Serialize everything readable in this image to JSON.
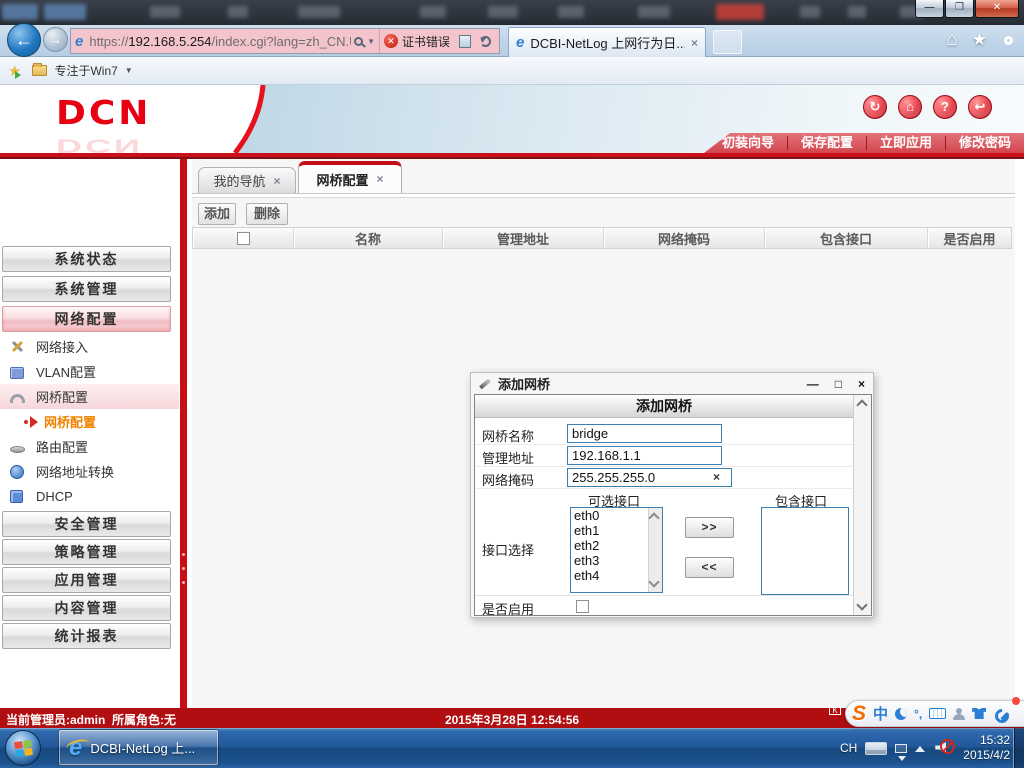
{
  "colors": {
    "brand_red": "#e60012",
    "toolbar_red": "#c9101b",
    "status_red": "#b10e12",
    "input_border": "#3c7fb1",
    "submenu_active_orange": "#f08300"
  },
  "chrome": {
    "url": {
      "scheme": "https://",
      "host": "192.168.5.254",
      "path": "/index.cgi?lang=zh_CN.U"
    },
    "cert_error": "证书错误",
    "tab_title": "DCBI-NetLog 上网行为日...",
    "favorites_item": "专注于Win7"
  },
  "header": {
    "logo": "DCN"
  },
  "ribbon": {
    "items": [
      {
        "label": "初装向导"
      },
      {
        "label": "保存配置"
      },
      {
        "label": "立即应用"
      },
      {
        "label": "修改密码"
      }
    ]
  },
  "sidebar": {
    "top_buttons": [
      {
        "label": "系统状态"
      },
      {
        "label": "系统管理"
      },
      {
        "label": "网络配置"
      }
    ],
    "submenu": [
      {
        "label": "网络接入"
      },
      {
        "label": "VLAN配置"
      },
      {
        "label": "网桥配置"
      },
      {
        "label": "网桥配置"
      },
      {
        "label": "路由配置"
      },
      {
        "label": "网络地址转换"
      },
      {
        "label": "DHCP"
      }
    ],
    "bottom_buttons": [
      {
        "label": "安全管理"
      },
      {
        "label": "策略管理"
      },
      {
        "label": "应用管理"
      },
      {
        "label": "内容管理"
      },
      {
        "label": "统计报表"
      }
    ]
  },
  "content": {
    "tabs": [
      {
        "label": "我的导航"
      },
      {
        "label": "网桥配置"
      }
    ],
    "add_label": "添加",
    "delete_label": "删除",
    "table_headers": [
      "名称",
      "管理地址",
      "网络掩码",
      "包含接口",
      "是否启用"
    ]
  },
  "dialog": {
    "title": "添加网桥",
    "panel_header": "添加网桥",
    "fields": {
      "name": {
        "label": "网桥名称",
        "value": "bridge"
      },
      "address": {
        "label": "管理地址",
        "value": "192.168.1.1"
      },
      "netmask": {
        "label": "网络掩码",
        "value": "255.255.255.0"
      }
    },
    "available_label": "可选接口",
    "included_label": "包含接口",
    "select_label": "接口选择",
    "enable_label": "是否启用",
    "move_right": ">>",
    "move_left": "<<",
    "interfaces": [
      "eth0",
      "eth1",
      "eth2",
      "eth3",
      "eth4"
    ]
  },
  "statusbar": {
    "admin": "当前管理员:admin",
    "role": "所属角色:无",
    "datetime": "2015年3月28日 12:54:56"
  },
  "taskbar": {
    "ie_button": "DCBI-NetLog 上...",
    "lang": "CH",
    "time": "15:32",
    "date": "2015/4/2"
  },
  "sogou": {
    "logo": "S",
    "mode": "中"
  }
}
